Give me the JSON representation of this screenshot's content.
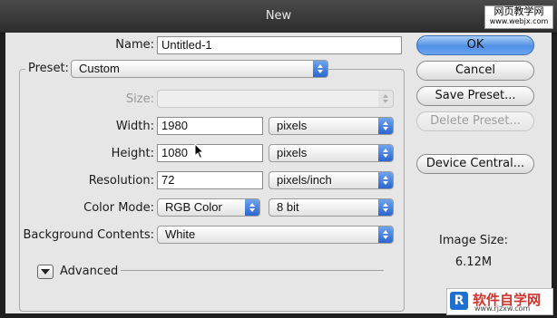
{
  "window": {
    "title": "New"
  },
  "watermark": {
    "top_line1": "网页教学网",
    "top_line2": "www.webjx.com",
    "bottom_logo": "R",
    "bottom_text": "软件自学网",
    "bottom_url": "www.rjzxw.com"
  },
  "form": {
    "name_label": "Name:",
    "name_value": "Untitled-1",
    "preset_label": "Preset:",
    "preset_value": "Custom",
    "size_label": "Size:",
    "size_value": "",
    "width_label": "Width:",
    "width_value": "1980",
    "width_unit": "pixels",
    "height_label": "Height:",
    "height_value": "1080",
    "height_unit": "pixels",
    "resolution_label": "Resolution:",
    "resolution_value": "72",
    "resolution_unit": "pixels/inch",
    "color_mode_label": "Color Mode:",
    "color_mode_value": "RGB Color",
    "bit_depth_value": "8 bit",
    "background_label": "Background Contents:",
    "background_value": "White",
    "advanced_label": "Advanced"
  },
  "buttons": {
    "ok": "OK",
    "cancel": "Cancel",
    "save_preset": "Save Preset...",
    "delete_preset": "Delete Preset...",
    "device_central": "Device Central..."
  },
  "image_size": {
    "label": "Image Size:",
    "value": "6.12M"
  },
  "colors": {
    "accent_blue": "#3f7fe0",
    "dialog_bg": "#e6e6e6",
    "titlebar": "#3a3a3a"
  },
  "icons": [
    "popup-arrows-icon",
    "disclosure-triangle-icon",
    "mouse-cursor-icon"
  ]
}
